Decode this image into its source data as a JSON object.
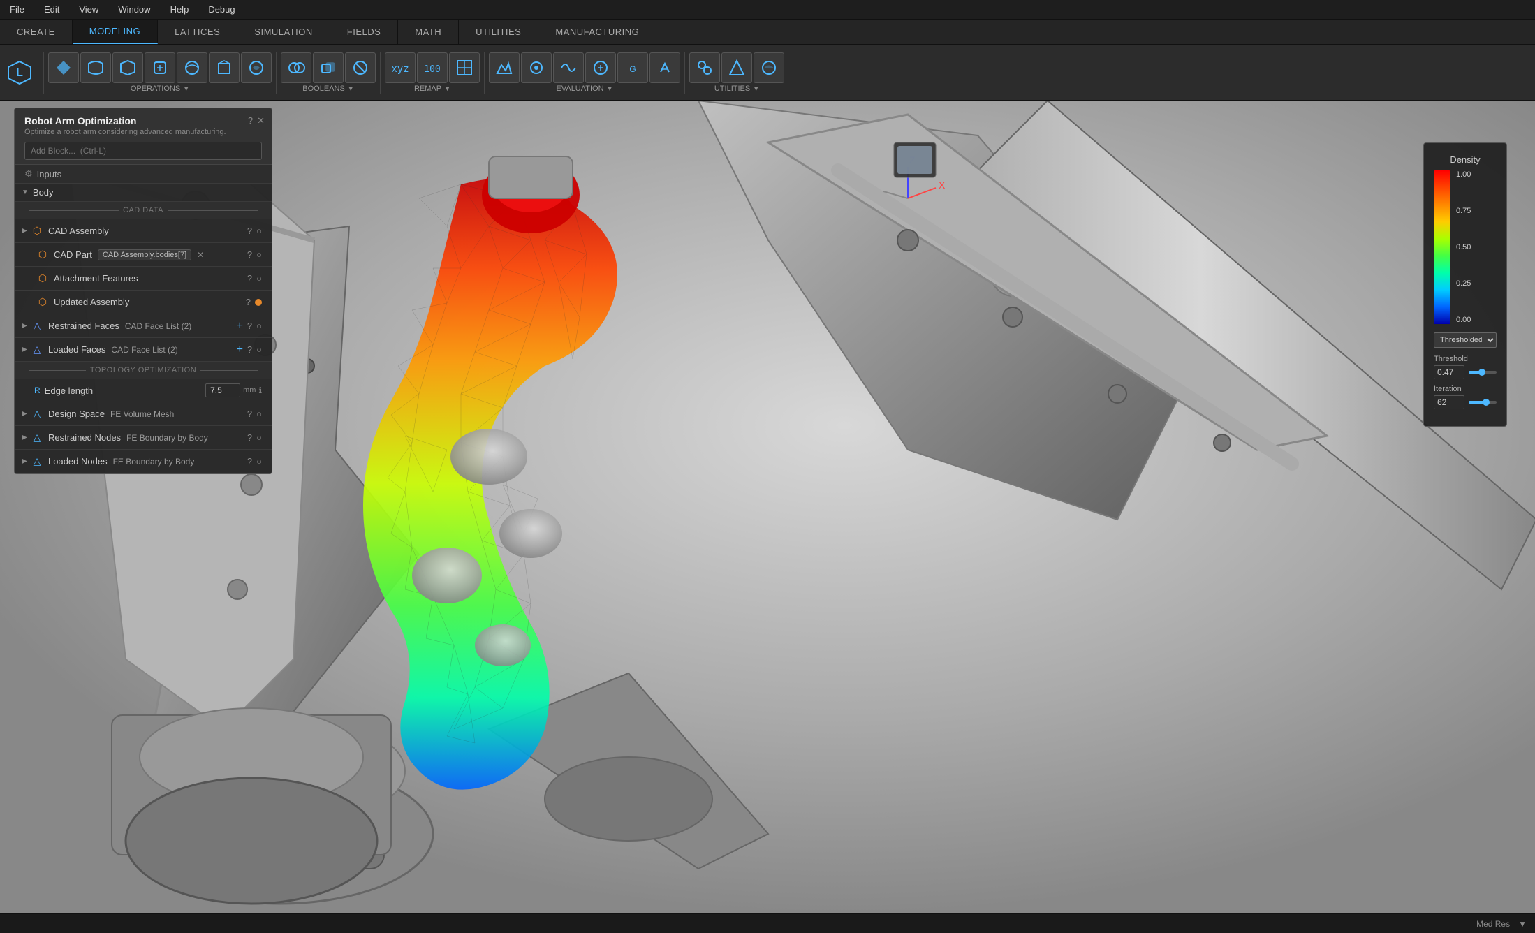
{
  "menu": {
    "items": [
      "File",
      "Edit",
      "View",
      "Window",
      "Help",
      "Debug"
    ]
  },
  "tabs": [
    {
      "label": "CREATE",
      "active": false
    },
    {
      "label": "MODELING",
      "active": true
    },
    {
      "label": "LATTICES",
      "active": false
    },
    {
      "label": "SIMULATION",
      "active": false
    },
    {
      "label": "FIELDS",
      "active": false
    },
    {
      "label": "MATH",
      "active": false
    },
    {
      "label": "UTILITIES",
      "active": false
    },
    {
      "label": "MANUFACTURING",
      "active": false
    }
  ],
  "toolbar": {
    "groups": [
      {
        "label": "OPERATIONS",
        "has_arrow": true
      },
      {
        "label": "BOOLEANS",
        "has_arrow": true
      },
      {
        "label": "REMAP",
        "has_arrow": true
      },
      {
        "label": "EVALUATION",
        "has_arrow": true
      },
      {
        "label": "UTILITIES",
        "has_arrow": true
      }
    ]
  },
  "panel": {
    "title": "Robot Arm Optimization",
    "subtitle": "Optimize a robot arm considering advanced manufacturing.",
    "add_block_placeholder": "Add Block...  (Ctrl-L)",
    "inputs_label": "Inputs",
    "body_label": "Body",
    "cad_data_label": "CAD DATA",
    "topo_label": "TOPOLOGY OPTIMIZATION",
    "items": [
      {
        "id": "cad-assembly",
        "label": "CAD Assembly",
        "icon_type": "orange",
        "icon": "⬡",
        "expandable": true
      },
      {
        "id": "cad-part",
        "label": "CAD Part",
        "tag": "CAD Assembly.bodies[7]",
        "show_close": true,
        "icon_type": "orange",
        "icon": "⬡",
        "expandable": false
      },
      {
        "id": "attachment-features",
        "label": "Attachment Features",
        "icon_type": "orange",
        "icon": "⬡",
        "expandable": false
      },
      {
        "id": "updated-assembly",
        "label": "Updated Assembly",
        "icon_type": "orange",
        "icon": "⬡",
        "has_dot": true,
        "dot_color": "orange",
        "expandable": false
      },
      {
        "id": "restrained-faces",
        "label": "Restrained Faces",
        "sub_label": "CAD Face List (2)",
        "icon_type": "blue",
        "icon": "△",
        "expandable": true,
        "has_add": true
      },
      {
        "id": "loaded-faces",
        "label": "Loaded Faces",
        "sub_label": "CAD Face List (2)",
        "icon_type": "blue",
        "icon": "△",
        "expandable": true,
        "has_add": true
      },
      {
        "id": "design-space",
        "label": "Design Space",
        "sub_label": "FE Volume Mesh",
        "icon_type": "cyan",
        "icon": "△",
        "expandable": true
      },
      {
        "id": "restrained-nodes",
        "label": "Restrained Nodes",
        "sub_label": "FE Boundary by Body",
        "icon_type": "cyan",
        "icon": "△",
        "expandable": true
      },
      {
        "id": "loaded-nodes",
        "label": "Loaded Nodes",
        "sub_label": "FE Boundary by Body",
        "icon_type": "cyan",
        "icon": "△",
        "expandable": true
      }
    ],
    "edge_length": {
      "label": "Edge length",
      "value": "7.5",
      "unit": "mm"
    }
  },
  "density_panel": {
    "title": "Density",
    "color_labels": [
      "1.00",
      "0.75",
      "0.50",
      "0.25",
      "0.00"
    ],
    "dropdown_label": "Thresholded el...",
    "threshold": {
      "label": "Threshold",
      "value": "0.47",
      "percent": 47
    },
    "iteration": {
      "label": "Iteration",
      "value": "62",
      "percent": 62
    }
  },
  "status_bar": {
    "resolution": "Med Res"
  }
}
